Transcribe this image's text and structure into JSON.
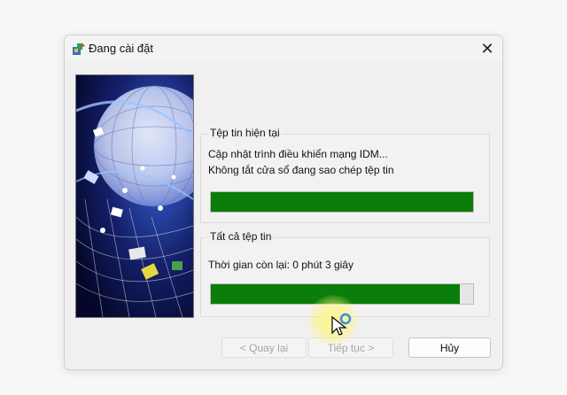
{
  "window": {
    "title": "Đang cài đặt",
    "close_glyph": "✕"
  },
  "current_file": {
    "group_label": "Tệp tin hiện tại",
    "line1": "Cập nhật trình điều khiển mạng IDM...",
    "line2": "Không tắt cửa sổ đang sao chép tệp tin",
    "progress_percent": 100
  },
  "all_files": {
    "group_label": "Tất cả tệp tin",
    "time_remaining": "Thời gian còn lại: 0 phút 3 giây",
    "progress_percent": 95
  },
  "buttons": {
    "back": "< Quay lại",
    "next": "Tiếp tục >",
    "cancel": "Hủy"
  },
  "colors": {
    "progress_fill": "#0a7d0a",
    "cursor_halo": "#fff578"
  },
  "icons": {
    "app": "installer-icon",
    "close": "close-icon",
    "pointer": "mouse-pointer-icon"
  }
}
